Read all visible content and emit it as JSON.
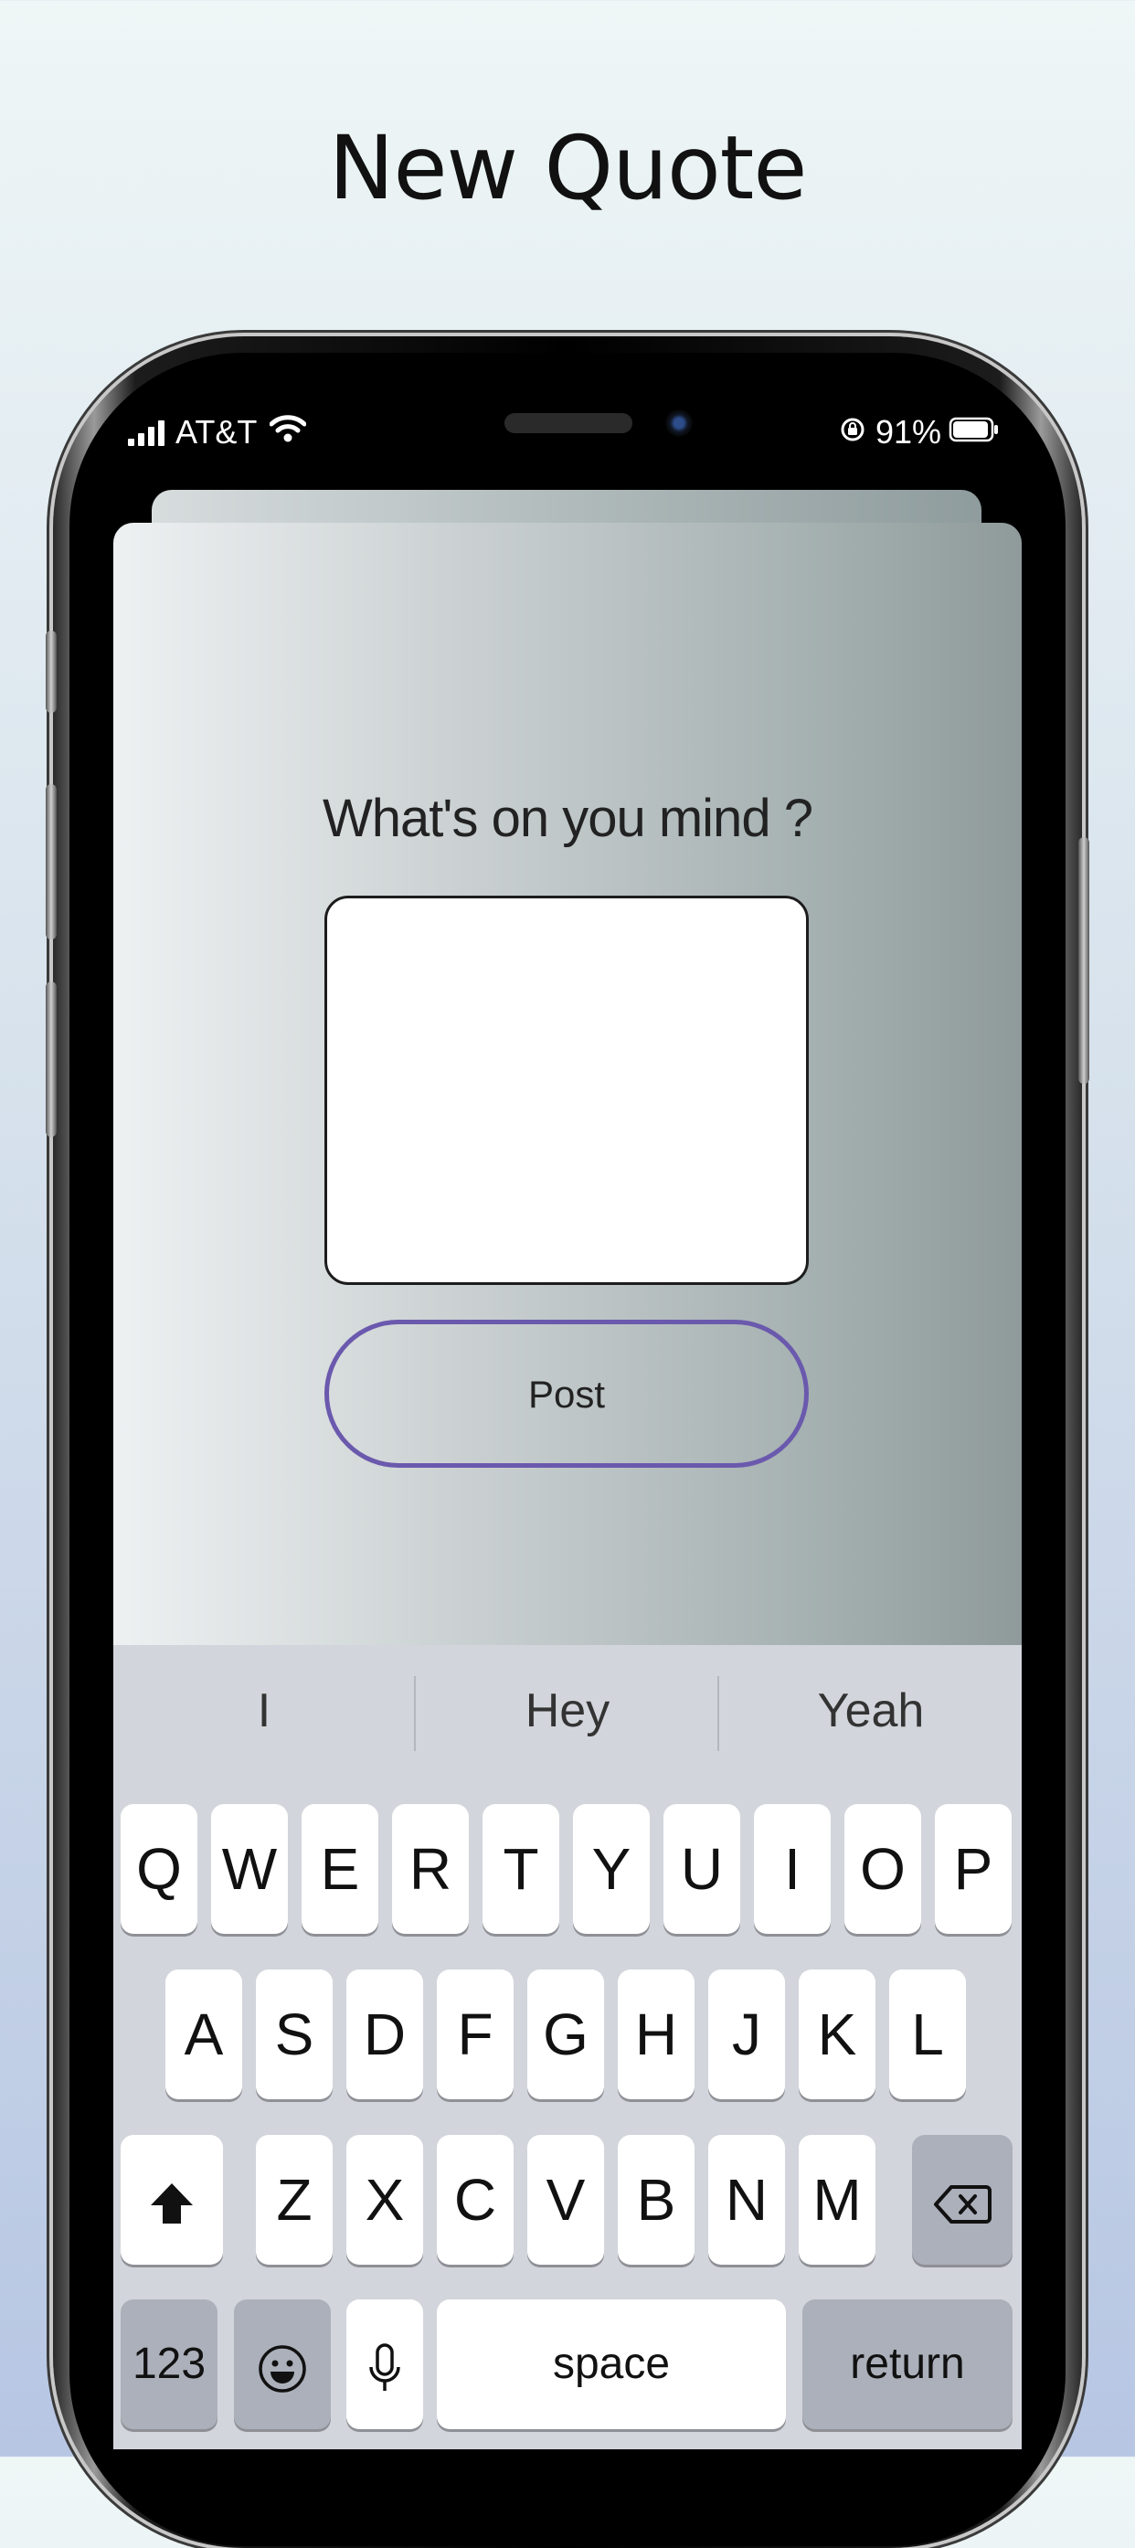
{
  "page": {
    "title": "New Quote"
  },
  "status_bar": {
    "carrier": "AT&T",
    "battery": "91%"
  },
  "compose": {
    "prompt": "What's on you mind ?",
    "input_value": "",
    "post_label": "Post"
  },
  "keyboard": {
    "suggestions": [
      "I",
      "Hey",
      "Yeah"
    ],
    "row1": [
      "Q",
      "W",
      "E",
      "R",
      "T",
      "Y",
      "U",
      "I",
      "O",
      "P"
    ],
    "row2": [
      "A",
      "S",
      "D",
      "F",
      "G",
      "H",
      "J",
      "K",
      "L"
    ],
    "row3": [
      "Z",
      "X",
      "C",
      "V",
      "B",
      "N",
      "M"
    ],
    "numbers_label": "123",
    "space_label": "space",
    "return_label": "return"
  }
}
